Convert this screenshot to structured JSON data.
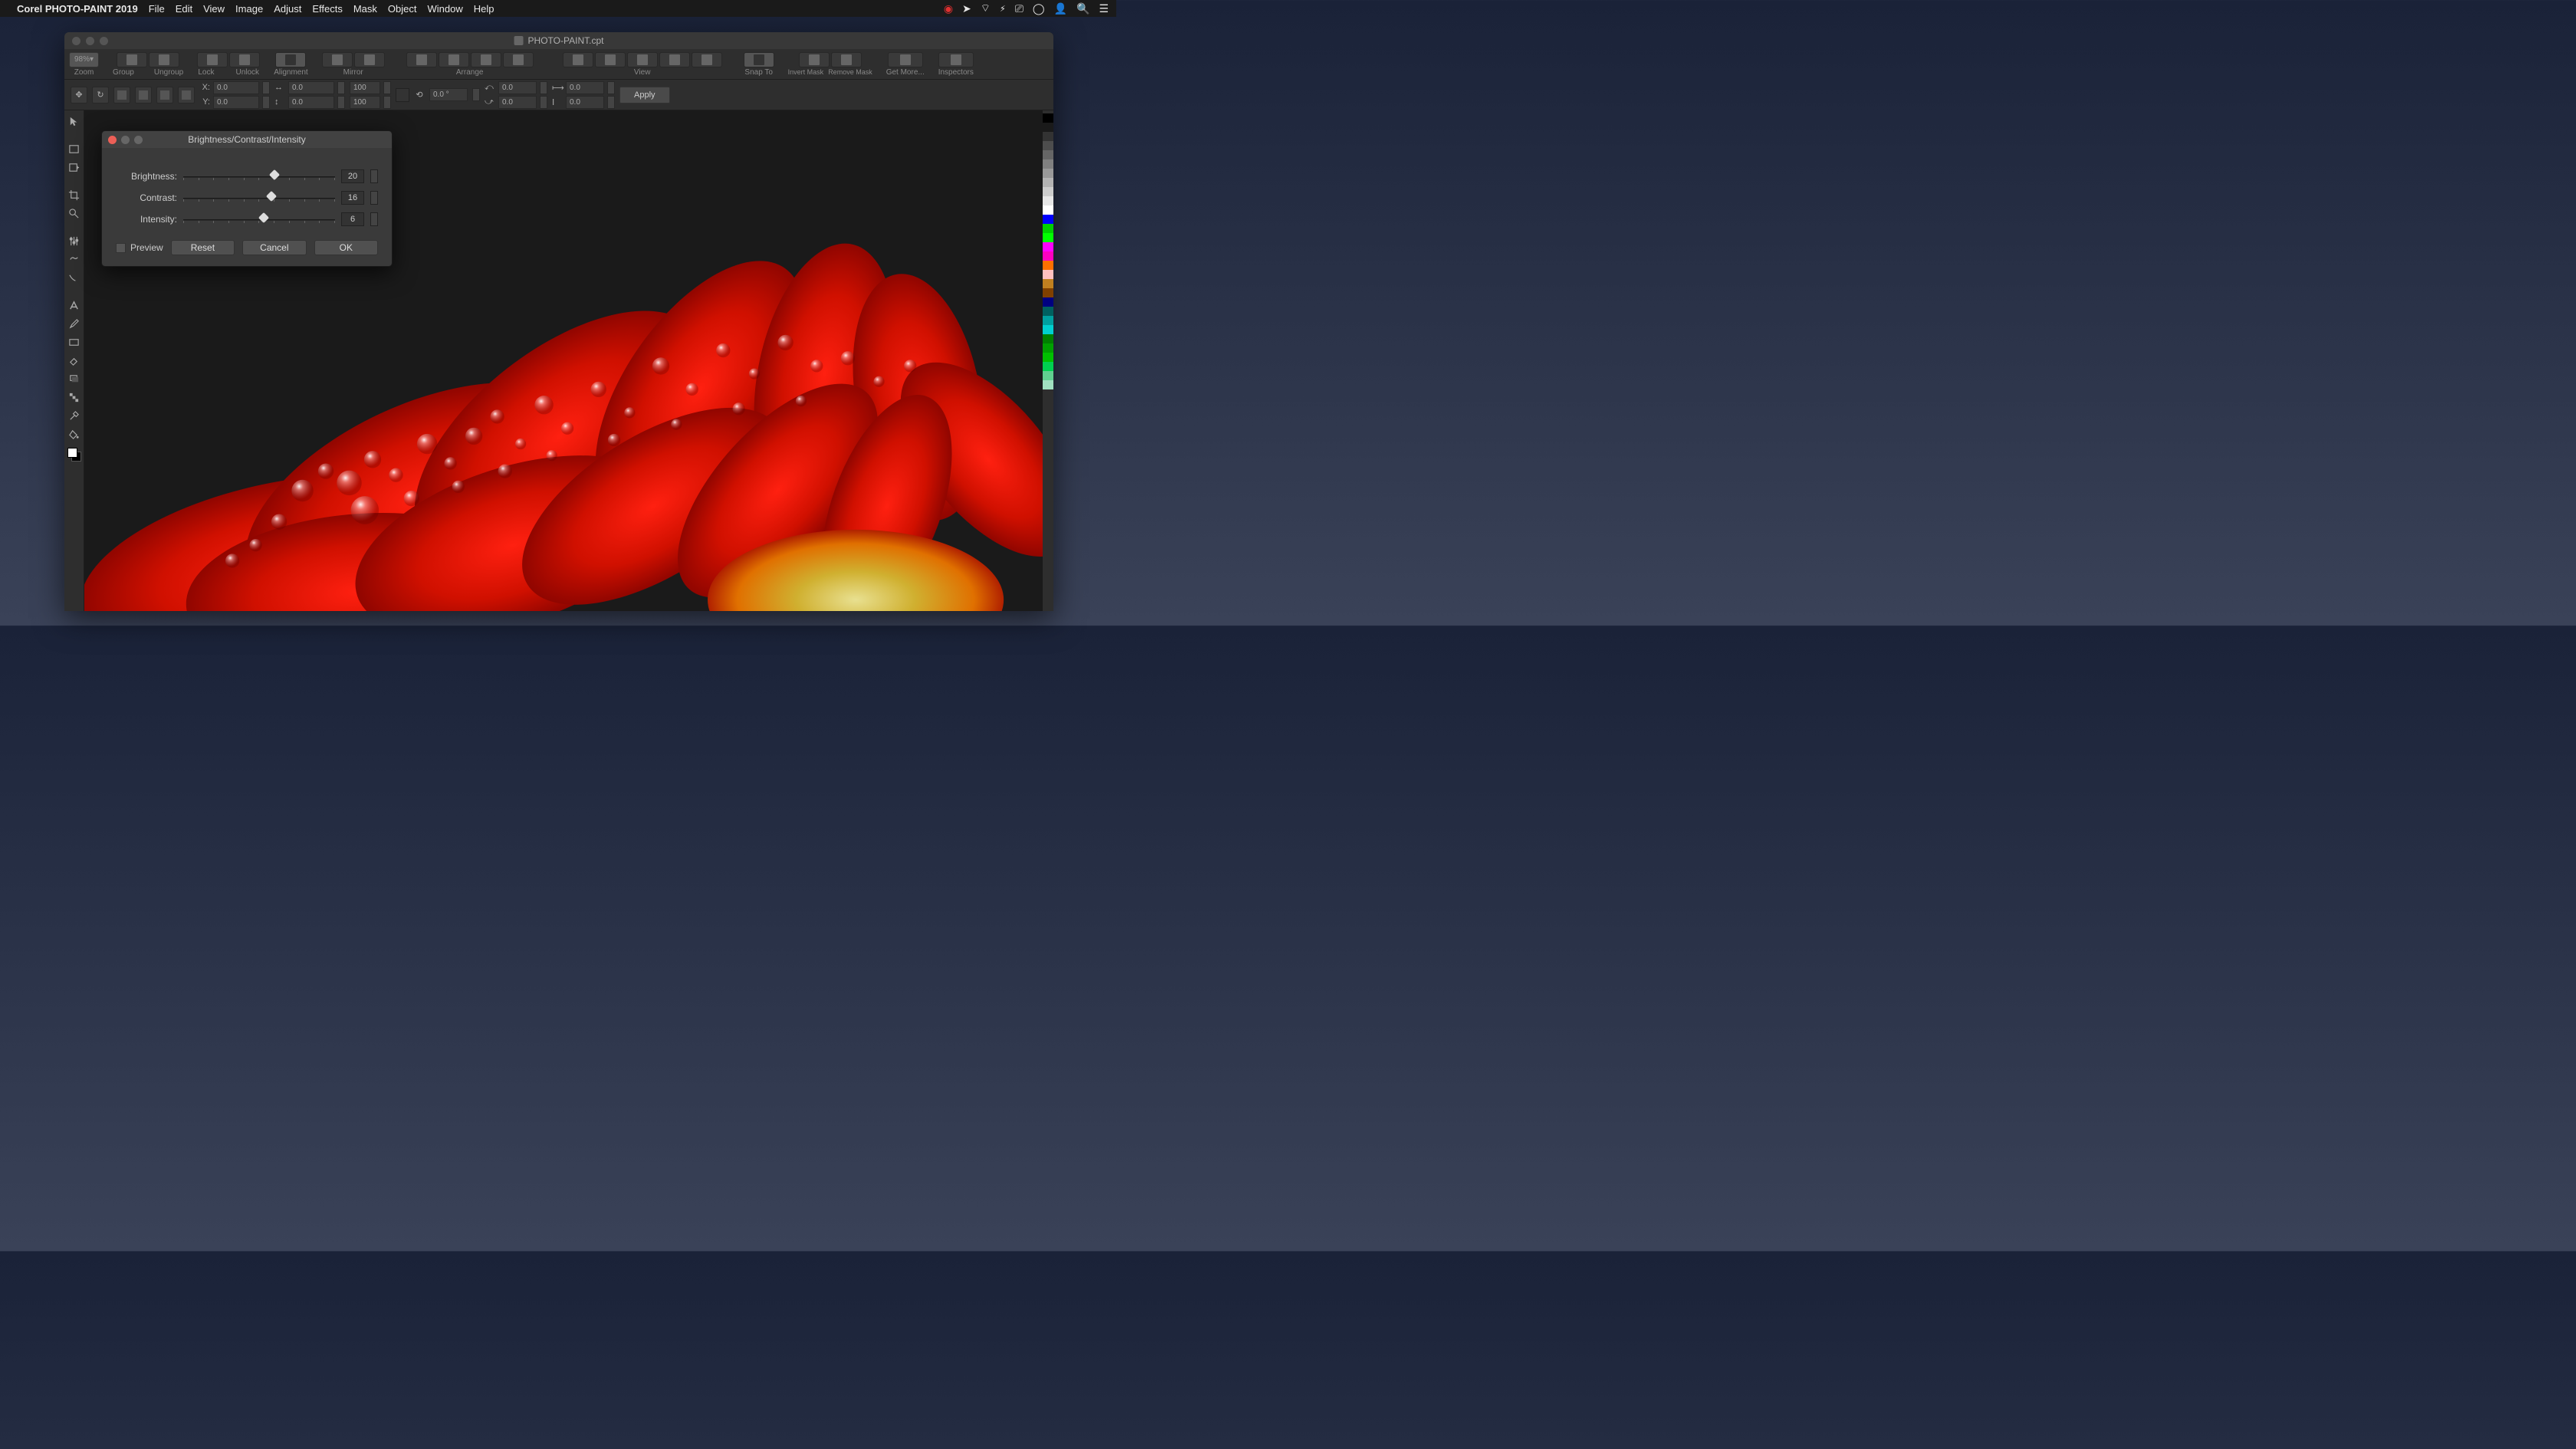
{
  "menubar": {
    "app_name": "Corel PHOTO-PAINT 2019",
    "items": [
      "File",
      "Edit",
      "View",
      "Image",
      "Adjust",
      "Effects",
      "Mask",
      "Object",
      "Window",
      "Help"
    ]
  },
  "window": {
    "title": "PHOTO-PAINT.cpt"
  },
  "toolbar": {
    "zoom_value": "98%",
    "groups": {
      "zoom": "Zoom",
      "group": "Group",
      "ungroup": "Ungroup",
      "lock": "Lock",
      "unlock": "Unlock",
      "alignment": "Alignment",
      "mirror": "Mirror",
      "arrange": "Arrange",
      "view": "View",
      "snapto": "Snap To",
      "invertmask": "Invert Mask",
      "removemask": "Remove Mask",
      "getmore": "Get More...",
      "inspectors": "Inspectors"
    }
  },
  "propbar": {
    "x_label": "X:",
    "y_label": "Y:",
    "x": "0.0",
    "y": "0.0",
    "w": "0.0",
    "h": "0.0",
    "sx": "100",
    "sy": "100",
    "rot": "0.0 °",
    "rx": "0.0",
    "ry": "0.0",
    "dw": "0.0",
    "dh": "0.0",
    "apply": "Apply"
  },
  "dialog": {
    "title": "Brightness/Contrast/Intensity",
    "brightness_label": "Brightness:",
    "contrast_label": "Contrast:",
    "intensity_label": "Intensity:",
    "brightness": "20",
    "contrast": "16",
    "intensity": "6",
    "preview": "Preview",
    "reset": "Reset",
    "cancel": "Cancel",
    "ok": "OK"
  },
  "colors": [
    "#000000",
    "#1a1a1a",
    "#333333",
    "#4d4d4d",
    "#666666",
    "#808080",
    "#999999",
    "#b3b3b3",
    "#cccccc",
    "#e6e6e6",
    "#ffffff",
    "#0000ff",
    "#00d000",
    "#00ff00",
    "#ff00ff",
    "#ff00c0",
    "#ff7000",
    "#ffc0c0",
    "#c08020",
    "#804000",
    "#000080",
    "#006060",
    "#00a0a0",
    "#00d0d0",
    "#008000",
    "#00a000",
    "#00c000",
    "#00d050",
    "#60d090",
    "#a0e0c0"
  ]
}
